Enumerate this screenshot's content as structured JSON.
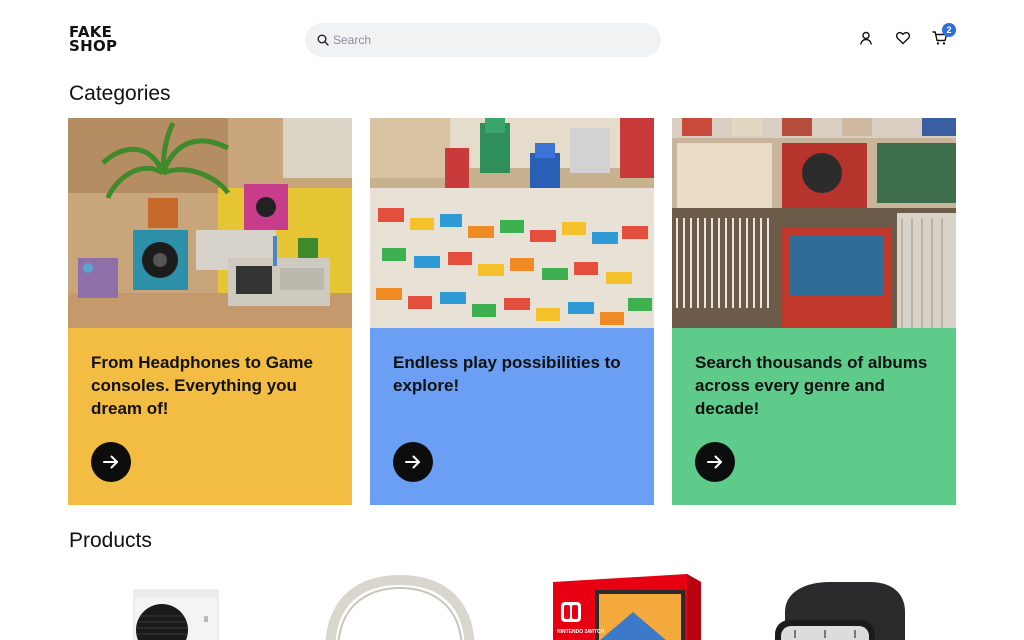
{
  "header": {
    "logo_line1": "FAKE",
    "logo_line2": "SHOP",
    "search_placeholder": "Search",
    "cart_count": "2",
    "icons": [
      "search-icon",
      "user-icon",
      "heart-icon",
      "cart-icon"
    ]
  },
  "categories": {
    "title": "Categories",
    "cards": [
      {
        "text": "From Headphones to Game consoles. Everything you dream of!",
        "color": "#f2bd42",
        "icon": "arrow-right-icon"
      },
      {
        "text": "Endless play possibilities to explore!",
        "color": "#6b9ff4",
        "icon": "arrow-right-icon"
      },
      {
        "text": "Search thousands of albums across every genre and decade!",
        "color": "#5ecb8a",
        "icon": "arrow-right-icon"
      }
    ]
  },
  "products": {
    "title": "Products",
    "items_visible": [
      "xbox-console-image",
      "headphones-image",
      "nintendo-switch-box-image",
      "smartwatch-image"
    ],
    "switch_box_text": "NINTENDO SWITCH"
  },
  "colors": {
    "search_bg": "#f1f2f4",
    "badge": "#2f6fd6",
    "button": "#0d0d0d"
  }
}
